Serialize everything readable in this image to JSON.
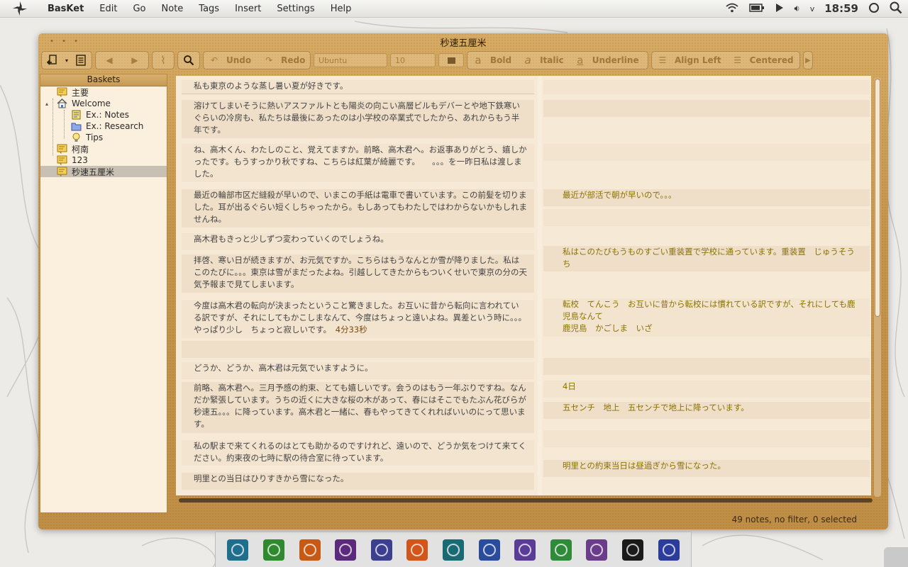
{
  "topbar": {
    "menus": [
      "BasKet",
      "Edit",
      "Go",
      "Note",
      "Tags",
      "Insert",
      "Settings",
      "Help"
    ],
    "clock": "18:59",
    "tray_icons": [
      "wifi-icon",
      "battery-icon",
      "play-icon",
      "volume-icon",
      "chevron-down-icon",
      "power-icon",
      "search-icon"
    ]
  },
  "window": {
    "title": "秒速五厘米",
    "toolbar": {
      "undo": "Undo",
      "redo": "Redo",
      "font_family": "Ubuntu",
      "font_size": "10",
      "bold": "Bold",
      "italic": "Italic",
      "underline": "Underline",
      "align_left": "Align Left",
      "centered": "Centered"
    },
    "tree": {
      "header": "Baskets",
      "items": [
        {
          "label": "主要"
        },
        {
          "label": "Welcome"
        },
        {
          "label": "Ex.: Notes"
        },
        {
          "label": "Ex.: Research"
        },
        {
          "label": "Tips"
        },
        {
          "label": "柯南"
        },
        {
          "label": "123"
        },
        {
          "label": "秒速五厘米"
        }
      ]
    },
    "notes_left": [
      "私も東京のような蒸し暑い夏が好きです。",
      "溶けてしまいそうに熱いアスファルトとも陽炎の向こい高層ビルもデバーとや地下鉄寒いぐらいの冷房も、私たちは最後にあったのは小学校の卒業式でしたから、あれからもう半年です。",
      "ね、高木くん、わたしのこと、覚えてますか。前略、高木君へ。お返事ありがとう、嬉しかったです。もうすっかり秋ですね、こちらは紅葉が綺麗です。　　。。。を一昨日私は渡しました。",
      "最近の輪部市区だ縫殺が早いので、いまこの手紙は電車で書いています。この前髪を切りました。耳が出るぐらい短くしちゃったから。もしあってもわたしではわからないかもしれませんね。",
      "高木君もきっと少しずつ変わっていくのでしょうね。",
      "拝啓、寒い日が続きますが、お元気ですか。こちらはもうなんとか雪が降りました。私はこのたびに。。。東京は雪がまだったよね。引越ししてきたからもついくせいで東京の分の天気予報まで見てしまいます。",
      "今度は高木君の転向が決まったということ驚きました。お互いに昔から転向に言われている訳ですが、それにしてもかこしまなんて、今度はちょっと遠いよね。異差という時に。。。やっぱり少し　ちょっと寂しいです。",
      "4分33秒",
      "どうか、どうか、高木君は元気でいますように。",
      "前略、高木君へ。三月予感の約束、とても嬉しいです。会うのはもう一年ぶりですね。なんだか緊張しています。うちの近くに大きな桜の木があって、春にはそこでもたぶん花びらが秒速五。。。に降っています。高木君と一緒に、春もやってきてくれればいいのにって思います。",
      "私の駅まで来てくれるのはとても助かるのですけれど、遠いので、どうか気をつけて来てください。約束夜の七時に駅の待合室に待っています。",
      "明里との当日はひりすきから雪になった。"
    ],
    "notes_right": [
      "最近が部活で朝が早いので。。。",
      "私はこのたびもうものすごい重装置で学校に通っています。重装置　じゅうそうち",
      "転校　てんこう　お互いに昔から転校には慣れている訳ですが、それにしても鹿児島なんて",
      "鹿児島　かごしま　いざ",
      "4日",
      "五センチ　地上　五センチで地上に降っています。",
      "明里との約束当日は昼過ぎから雪になった。"
    ],
    "status": "49 notes, no filter, 0 selected"
  },
  "dock": {
    "apps": [
      {
        "name": "chat-app-icon",
        "color": "#1f6e8c"
      },
      {
        "name": "im-app-icon",
        "color": "#2f8a2f"
      },
      {
        "name": "firefox-icon",
        "color": "#c65a14"
      },
      {
        "name": "music-app-icon",
        "color": "#5b2a7a"
      },
      {
        "name": "video-app-icon",
        "color": "#3c3f8f"
      },
      {
        "name": "rss-app-icon",
        "color": "#d2561a"
      },
      {
        "name": "browser-app-icon",
        "color": "#1a6a74"
      },
      {
        "name": "cat-app-icon",
        "color": "#2b4c9c"
      },
      {
        "name": "writer-app-icon",
        "color": "#5a3c96"
      },
      {
        "name": "android-app-icon",
        "color": "#2f8a3a"
      },
      {
        "name": "phone-app-icon",
        "color": "#6a3c8a"
      },
      {
        "name": "terminal-icon",
        "color": "#1a1a1a"
      },
      {
        "name": "photoshop-icon",
        "color": "#2b3c9a"
      }
    ]
  }
}
